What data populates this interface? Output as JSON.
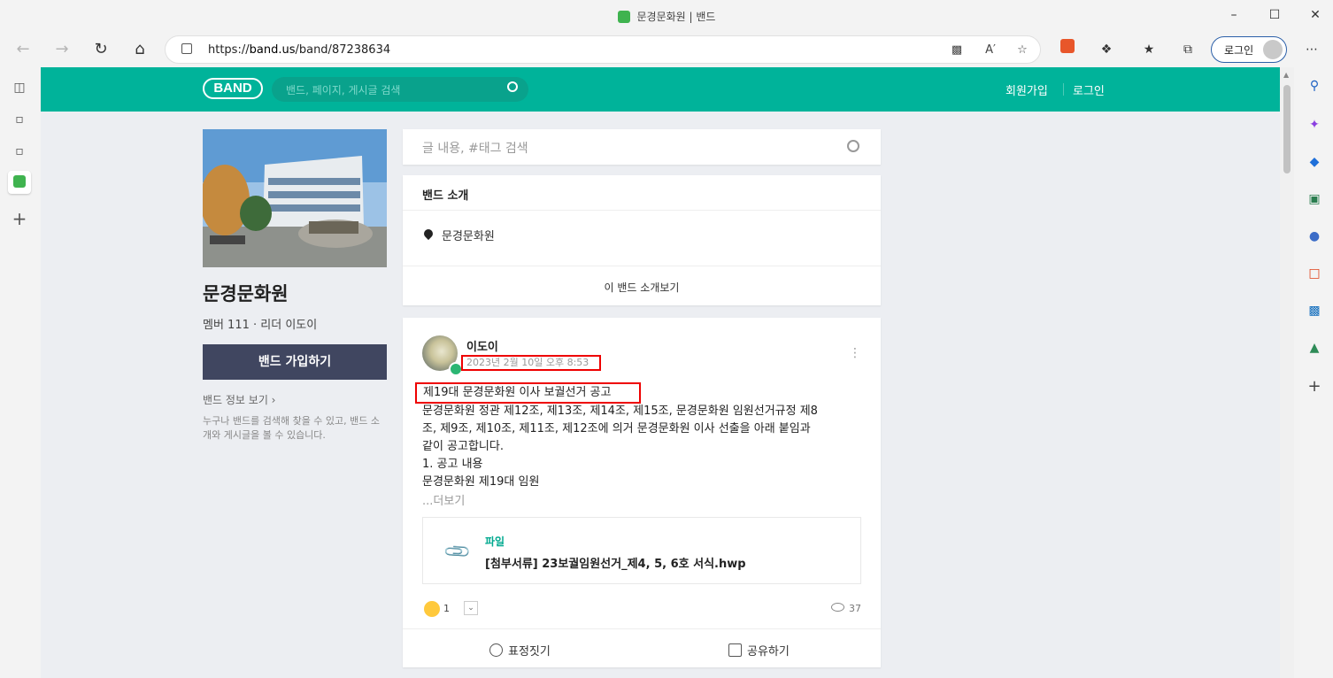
{
  "window": {
    "title": "문경문화원 | 밴드",
    "controls": [
      "minimize-icon",
      "maximize-icon",
      "close-icon"
    ]
  },
  "browser": {
    "url_prefix": "https://",
    "url_host": "band.us",
    "url_path": "/band/87238634",
    "login_label": "로그인"
  },
  "band_header": {
    "logo": "BAND",
    "search_placeholder": "밴드, 페이지, 게시글 검색",
    "signup": "회원가입",
    "login": "로그인"
  },
  "band": {
    "name": "문경문화원",
    "meta": "멤버 111 · 리더 이도이",
    "join_button": "밴드 가입하기",
    "info_link": "밴드 정보 보기 ›",
    "description": "누구나 밴드를 검색해 찾을 수 있고, 밴드 소개와 게시글을 볼 수 있습니다."
  },
  "post_search": {
    "placeholder": "글 내용, #태그 검색"
  },
  "intro": {
    "title": "밴드 소개",
    "location": "문경문화원",
    "more": "이 밴드 소개보기"
  },
  "post": {
    "author": "이도이",
    "date": "2023년 2월 10일 오후 8:53",
    "headline": "제19대 문경문화원 이사 보궐선거 공고",
    "body_lines": [
      "문경문화원 정관 제12조, 제13조, 제14조, 제15조, 문경문화원 임원선거규정 제8",
      "조, 제9조, 제10조, 제11조, 제12조에 의거 문경문화원 이사 선출을 아래 붙임과",
      "같이 공고합니다.",
      "1. 공고 내용",
      "문경문화원 제19대 임원"
    ],
    "more": "...더보기",
    "file_label": "파일",
    "file_name": "[첨부서류] 23보궐임원선거_제4, 5, 6호 서식.hwp",
    "reaction_count": "1",
    "views": "37",
    "actions": {
      "emotion": "표정짓기",
      "share": "공유하기"
    }
  },
  "colors": {
    "band_green": "#00b39a",
    "join_button": "#404660",
    "highlight_border": "#e00000"
  }
}
